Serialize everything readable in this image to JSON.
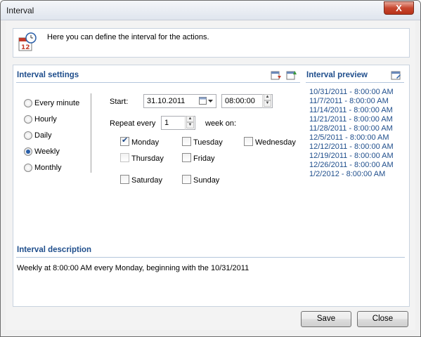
{
  "window": {
    "title": "Interval",
    "close_glyph": "X"
  },
  "intro": {
    "text": "Here you can define the interval for the actions.",
    "icon": "calendar-clock-icon"
  },
  "interval_settings": {
    "title": "Interval settings",
    "modes": [
      {
        "label": "Every minute",
        "selected": false
      },
      {
        "label": "Hourly",
        "selected": false
      },
      {
        "label": "Daily",
        "selected": false
      },
      {
        "label": "Weekly",
        "selected": true
      },
      {
        "label": "Monthly",
        "selected": false
      }
    ],
    "start_label": "Start:",
    "start_date": "31.10.2011",
    "start_time": "08:00:00",
    "repeat_label": "Repeat every",
    "repeat_value": "1",
    "repeat_suffix": "week on:",
    "days": {
      "monday": {
        "label": "Monday",
        "checked": true
      },
      "tuesday": {
        "label": "Tuesday",
        "checked": false
      },
      "wednesday": {
        "label": "Wednesday",
        "checked": false
      },
      "thursday": {
        "label": "Thursday",
        "checked": false
      },
      "friday": {
        "label": "Friday",
        "checked": false
      },
      "saturday": {
        "label": "Saturday",
        "checked": false
      },
      "sunday": {
        "label": "Sunday",
        "checked": false
      }
    }
  },
  "interval_preview": {
    "title": "Interval preview",
    "items": [
      "10/31/2011 - 8:00:00 AM",
      "11/7/2011 - 8:00:00 AM",
      "11/14/2011 - 8:00:00 AM",
      "11/21/2011 - 8:00:00 AM",
      "11/28/2011 - 8:00:00 AM",
      "12/5/2011 - 8:00:00 AM",
      "12/12/2011 - 8:00:00 AM",
      "12/19/2011 - 8:00:00 AM",
      "12/26/2011 - 8:00:00 AM",
      "1/2/2012 - 8:00:00 AM"
    ]
  },
  "interval_description": {
    "title": "Interval description",
    "text": "Weekly at 8:00:00 AM every Monday, beginning with the 10/31/2011"
  },
  "buttons": {
    "save": "Save",
    "close": "Close"
  },
  "colors": {
    "accent": "#1f4e8c",
    "panel_border": "#c9d3df"
  }
}
